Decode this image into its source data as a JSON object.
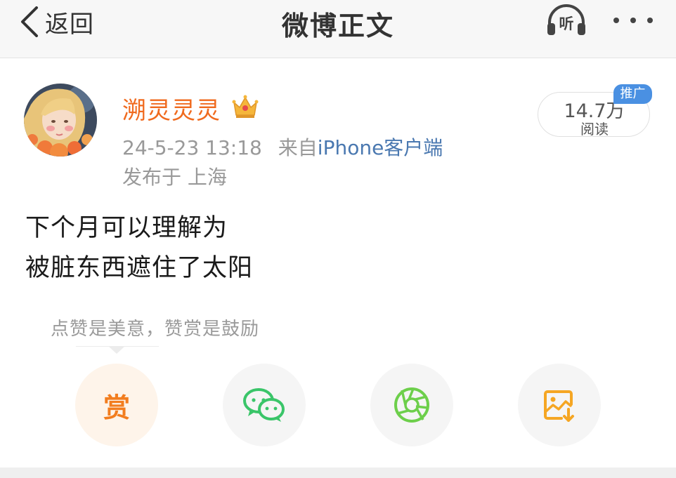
{
  "nav": {
    "back_label": "返回",
    "title": "微博正文",
    "listen_label": "听"
  },
  "post": {
    "username": "溯灵灵灵",
    "timestamp": "24-5-23 13:18",
    "from_prefix": "来自",
    "source": "iPhone客户端",
    "location": "发布于 上海",
    "read_count": "14.7万",
    "read_label": "阅读",
    "promo_tag": "推广",
    "text_lines": [
      "下个月可以理解为",
      "被脏东西遮住了太阳"
    ]
  },
  "actions": {
    "tip": "点赞是美意，赞赏是鼓励",
    "reward_label": "赏"
  },
  "colors": {
    "username": "#f06a1e",
    "source_link": "#4a78b0",
    "promo": "#4a90e2",
    "reward": "#f27d1f",
    "wechat": "#3ac569",
    "moments": "#6dcf4b",
    "save": "#f5a623"
  },
  "icons": [
    "back-chevron-icon",
    "headphones-icon",
    "more-dots-icon",
    "crown-icon",
    "wechat-icon",
    "moments-shutter-icon",
    "save-image-icon"
  ]
}
